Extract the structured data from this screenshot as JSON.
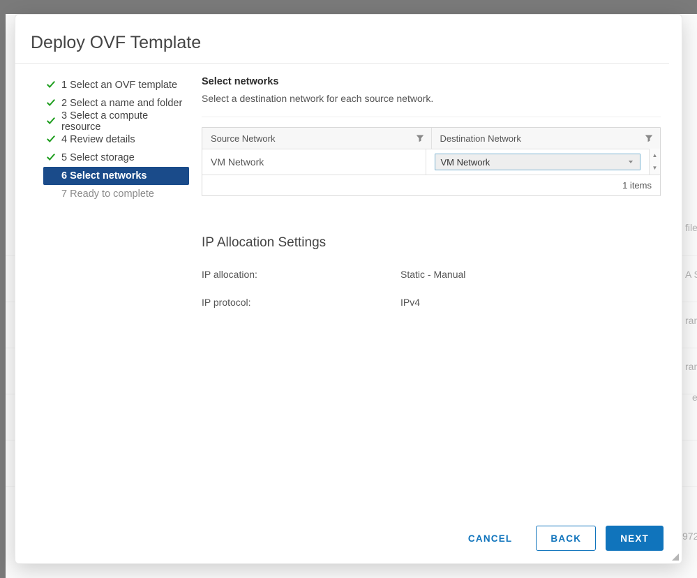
{
  "dialog": {
    "title": "Deploy OVF Template"
  },
  "steps": [
    {
      "label": "1 Select an OVF template",
      "state": "done"
    },
    {
      "label": "2 Select a name and folder",
      "state": "done"
    },
    {
      "label": "3 Select a compute resource",
      "state": "done"
    },
    {
      "label": "4 Review details",
      "state": "done"
    },
    {
      "label": "5 Select storage",
      "state": "done"
    },
    {
      "label": "6 Select networks",
      "state": "active"
    },
    {
      "label": "7 Ready to complete",
      "state": "future"
    }
  ],
  "section": {
    "title": "Select networks",
    "desc": "Select a destination network for each source network."
  },
  "table": {
    "cols": {
      "source": "Source Network",
      "dest": "Destination Network"
    },
    "rows": [
      {
        "source": "VM Network",
        "dest": "VM Network"
      }
    ],
    "footer": "1 items"
  },
  "ip": {
    "title": "IP Allocation Settings",
    "alloc_k": "IP allocation:",
    "alloc_v": "Static - Manual",
    "proto_k": "IP protocol:",
    "proto_v": "IPv4"
  },
  "buttons": {
    "cancel": "CANCEL",
    "back": "BACK",
    "next": "NEXT"
  },
  "background_fragments": [
    "file",
    "A S",
    "ran",
    "ran",
    "e",
    "972"
  ]
}
